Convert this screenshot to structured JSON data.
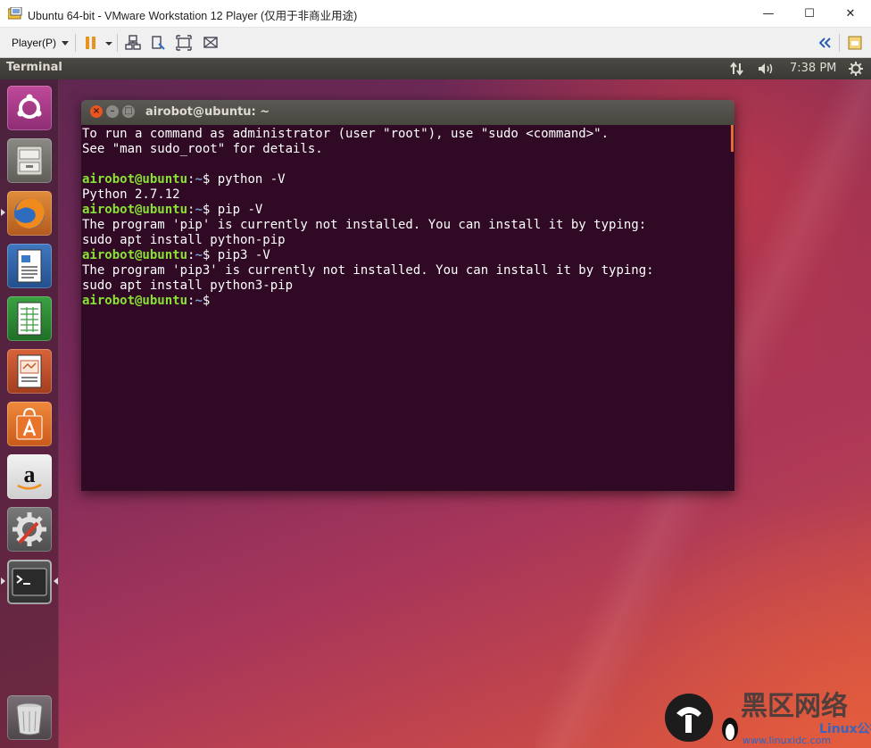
{
  "vm": {
    "window_title": "Ubuntu 64-bit - VMware Workstation 12 Player (仅用于非商业用途)",
    "player_menu": "Player(P)",
    "controls": {
      "minimize": "—",
      "maximize": "☐",
      "close": "✕"
    }
  },
  "panel": {
    "app_title": "Terminal",
    "clock": "7:38 PM"
  },
  "terminal": {
    "title": "airobot@ubuntu: ~",
    "user_host": "airobot@ubuntu",
    "cwd": "~",
    "lines": [
      {
        "type": "text",
        "text": "To run a command as administrator (user \"root\"), use \"sudo <command>\"."
      },
      {
        "type": "text",
        "text": "See \"man sudo_root\" for details."
      },
      {
        "type": "text",
        "text": ""
      },
      {
        "type": "prompt",
        "cmd": "python -V"
      },
      {
        "type": "text",
        "text": "Python 2.7.12"
      },
      {
        "type": "prompt",
        "cmd": "pip -V"
      },
      {
        "type": "text",
        "text": "The program 'pip' is currently not installed. You can install it by typing:"
      },
      {
        "type": "text",
        "text": "sudo apt install python-pip"
      },
      {
        "type": "prompt",
        "cmd": "pip3 -V"
      },
      {
        "type": "text",
        "text": "The program 'pip3' is currently not installed. You can install it by typing:"
      },
      {
        "type": "text",
        "text": "sudo apt install python3-pip"
      },
      {
        "type": "prompt",
        "cmd": ""
      }
    ]
  },
  "launcher": {
    "items": [
      {
        "name": "ubuntu-dash",
        "icon": "ubuntu-logo-icon"
      },
      {
        "name": "files",
        "icon": "file-cabinet-icon"
      },
      {
        "name": "firefox",
        "icon": "firefox-icon"
      },
      {
        "name": "writer",
        "icon": "document-icon"
      },
      {
        "name": "calc",
        "icon": "spreadsheet-icon"
      },
      {
        "name": "impress",
        "icon": "presentation-icon"
      },
      {
        "name": "software-center",
        "icon": "shopping-bag-icon"
      },
      {
        "name": "amazon",
        "icon": "amazon-icon"
      },
      {
        "name": "system-settings",
        "icon": "settings-gear-icon"
      },
      {
        "name": "terminal",
        "icon": "terminal-icon"
      },
      {
        "name": "trash",
        "icon": "trash-icon"
      }
    ]
  },
  "watermark": {
    "text": "黑区网络",
    "site": "www.linuxidc.com",
    "brand": "Linux公社"
  }
}
